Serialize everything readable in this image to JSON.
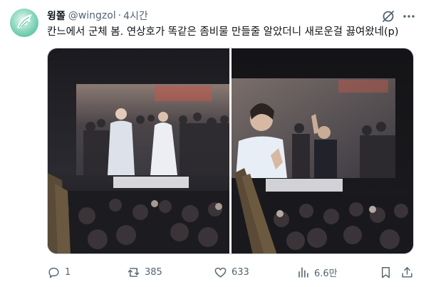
{
  "post": {
    "display_name": "윙쫄",
    "handle": "@wingzol",
    "separator": "·",
    "time": "4시간",
    "text": "칸느에서 군체 봄. 연상호가 똑같은 좀비물 만들줄 알았더니 새로운걸 끓여왔네(p)"
  },
  "actions": {
    "replies": "1",
    "reposts": "385",
    "likes": "633",
    "views": "6.6만"
  },
  "icons": {
    "avatar": "angel-wing-avatar",
    "grok": "grok-icon",
    "more": "more-dots-icon",
    "reply": "reply-icon",
    "repost": "repost-icon",
    "like": "heart-icon",
    "views": "views-icon",
    "bookmark": "bookmark-icon",
    "share": "share-icon"
  },
  "colors": {
    "text_primary": "#0f1419",
    "text_secondary": "#536471",
    "border": "#cfd9de"
  }
}
